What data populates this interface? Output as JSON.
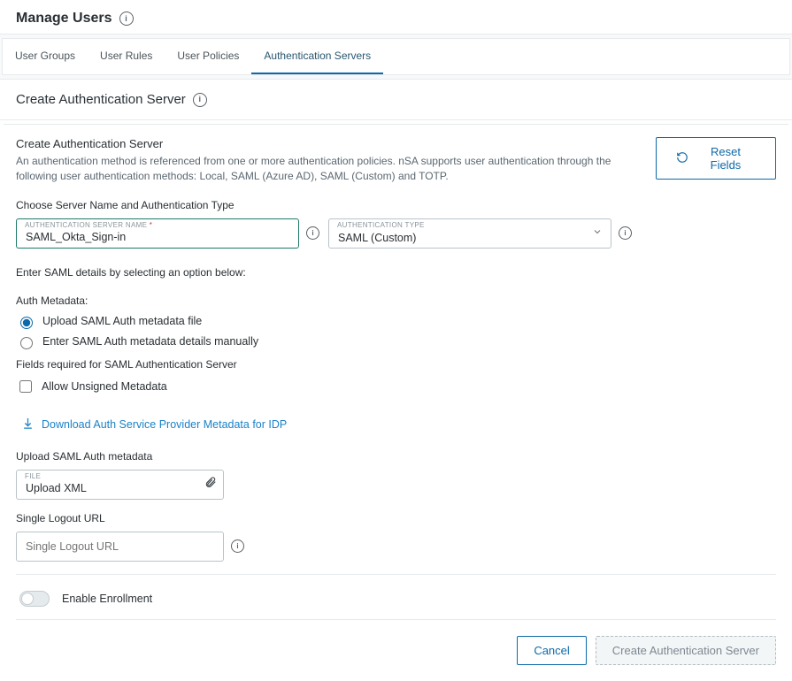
{
  "header": {
    "title": "Manage Users"
  },
  "tabs": {
    "items": [
      {
        "label": "User Groups",
        "active": false
      },
      {
        "label": "User Rules",
        "active": false
      },
      {
        "label": "User Policies",
        "active": false
      },
      {
        "label": "Authentication Servers",
        "active": true
      }
    ]
  },
  "section": {
    "title": "Create Authentication Server"
  },
  "intro": {
    "title": "Create Authentication Server",
    "desc": "An authentication method is referenced from one or more authentication policies. nSA supports user authentication through the following user authentication methods: Local, SAML (Azure AD), SAML (Custom) and TOTP."
  },
  "reset": {
    "label": "Reset Fields"
  },
  "chooseLabel": "Choose Server Name and Authentication Type",
  "name": {
    "label": "Authentication Server Name",
    "value": "SAML_Okta_Sign-in"
  },
  "type": {
    "label": "Authentication Type",
    "value": "SAML (Custom)"
  },
  "samlIntro": "Enter SAML details by selecting an option below:",
  "authMeta": {
    "label": "Auth Metadata:",
    "uploadOpt": "Upload SAML Auth metadata file",
    "manualOpt": "Enter SAML Auth metadata details manually"
  },
  "required": {
    "label": "Fields required for SAML Authentication Server",
    "allowUnsigned": "Allow Unsigned Metadata"
  },
  "dl": "Download Auth Service Provider Metadata for IDP",
  "upload": {
    "section": "Upload SAML Auth metadata",
    "fieldLabel": "File",
    "value": "Upload XML"
  },
  "slo": {
    "section": "Single Logout URL",
    "placeholder": "Single Logout URL"
  },
  "enroll": {
    "label": "Enable Enrollment"
  },
  "footer": {
    "cancel": "Cancel",
    "create": "Create Authentication Server"
  }
}
